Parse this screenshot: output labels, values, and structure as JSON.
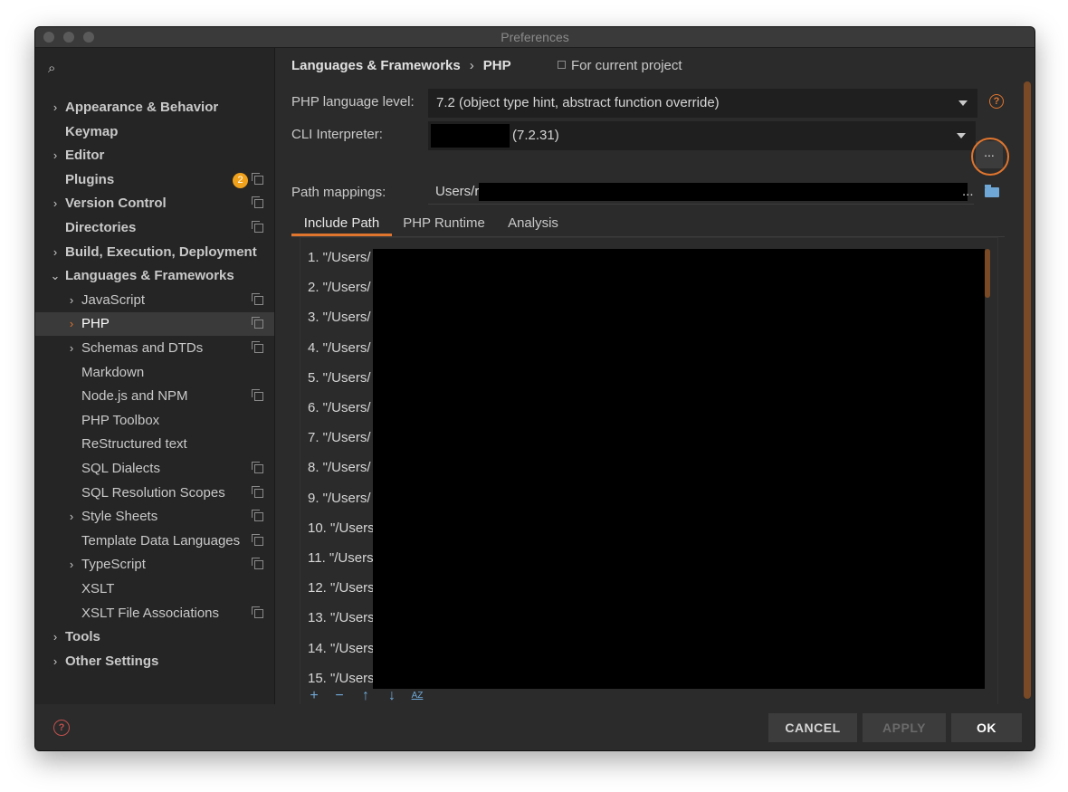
{
  "window": {
    "title": "Preferences"
  },
  "sidebar": {
    "items": [
      {
        "label": "Appearance & Behavior",
        "bold": true,
        "chevron": true,
        "indent": 0
      },
      {
        "label": "Keymap",
        "bold": true,
        "chevron": false,
        "indent": 0
      },
      {
        "label": "Editor",
        "bold": true,
        "chevron": true,
        "indent": 0
      },
      {
        "label": "Plugins",
        "bold": true,
        "chevron": false,
        "indent": 0,
        "badge": "2",
        "copy": true
      },
      {
        "label": "Version Control",
        "bold": true,
        "chevron": true,
        "indent": 0,
        "copy": true
      },
      {
        "label": "Directories",
        "bold": true,
        "chevron": false,
        "indent": 0,
        "copy": true
      },
      {
        "label": "Build, Execution, Deployment",
        "bold": true,
        "chevron": true,
        "indent": 0
      },
      {
        "label": "Languages & Frameworks",
        "bold": true,
        "chevron": "open",
        "indent": 0
      },
      {
        "label": "JavaScript",
        "chevron": true,
        "indent": 1,
        "copy": true
      },
      {
        "label": "PHP",
        "chevron": true,
        "indent": 1,
        "copy": true,
        "selected": true
      },
      {
        "label": "Schemas and DTDs",
        "chevron": true,
        "indent": 1,
        "copy": true
      },
      {
        "label": "Markdown",
        "chevron": false,
        "indent": 1
      },
      {
        "label": "Node.js and NPM",
        "chevron": false,
        "indent": 1,
        "copy": true
      },
      {
        "label": "PHP Toolbox",
        "chevron": false,
        "indent": 1
      },
      {
        "label": "ReStructured text",
        "chevron": false,
        "indent": 1
      },
      {
        "label": "SQL Dialects",
        "chevron": false,
        "indent": 1,
        "copy": true
      },
      {
        "label": "SQL Resolution Scopes",
        "chevron": false,
        "indent": 1,
        "copy": true
      },
      {
        "label": "Style Sheets",
        "chevron": true,
        "indent": 1,
        "copy": true
      },
      {
        "label": "Template Data Languages",
        "chevron": false,
        "indent": 1,
        "copy": true
      },
      {
        "label": "TypeScript",
        "chevron": true,
        "indent": 1,
        "copy": true
      },
      {
        "label": "XSLT",
        "chevron": false,
        "indent": 1
      },
      {
        "label": "XSLT File Associations",
        "chevron": false,
        "indent": 1,
        "copy": true
      },
      {
        "label": "Tools",
        "bold": true,
        "chevron": true,
        "indent": 0
      },
      {
        "label": "Other Settings",
        "bold": true,
        "chevron": true,
        "indent": 0
      }
    ]
  },
  "breadcrumb": {
    "parent": "Languages & Frameworks",
    "separator": "›",
    "current": "PHP"
  },
  "scope": {
    "label": "For current project"
  },
  "settings": {
    "language_level_label": "PHP language level:",
    "language_level_value": "7.2 (object type hint, abstract function override)",
    "cli_label": "CLI Interpreter:",
    "cli_value": "(7.2.31)",
    "path_label": "Path mappings:",
    "path_value": "Users/r",
    "path_ellipsis": "...",
    "browse_label": "..."
  },
  "tabs": [
    {
      "label": "Include Path",
      "active": true
    },
    {
      "label": "PHP Runtime",
      "active": false
    },
    {
      "label": "Analysis",
      "active": false
    }
  ],
  "include_paths": [
    "1. \"/Users/",
    "2. \"/Users/",
    "3. \"/Users/",
    "4. \"/Users/",
    "5. \"/Users/",
    "6. \"/Users/",
    "7. \"/Users/",
    "8. \"/Users/",
    "9. \"/Users/",
    "10. \"/Users",
    "11. \"/Users",
    "12. \"/Users",
    "13. \"/Users",
    "14. \"/Users",
    "15. \"/Users"
  ],
  "list_toolbar": {
    "add": "+",
    "remove": "−",
    "up": "↑",
    "down": "↓",
    "sort": "AZ"
  },
  "footer": {
    "cancel": "CANCEL",
    "apply": "APPLY",
    "ok": "OK",
    "help": "?"
  },
  "colors": {
    "accent": "#e0752e",
    "badge": "#f0a11c",
    "link_blue": "#6fa7d6"
  }
}
